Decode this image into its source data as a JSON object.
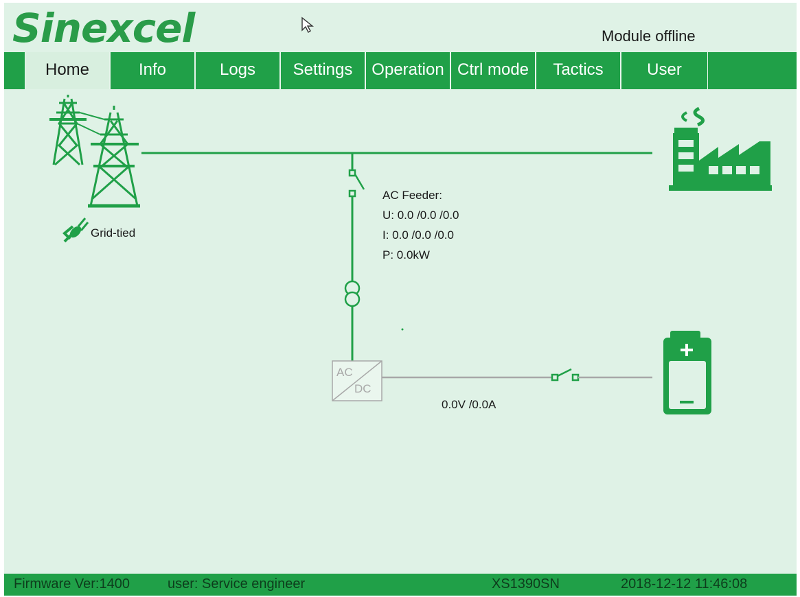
{
  "header": {
    "logo": "Sinexcel",
    "module_status": "Module offline"
  },
  "nav": {
    "tabs": [
      {
        "label": "Home"
      },
      {
        "label": "Info"
      },
      {
        "label": "Logs"
      },
      {
        "label": "Settings"
      },
      {
        "label": "Operation"
      },
      {
        "label": "Ctrl mode"
      },
      {
        "label": "Tactics"
      },
      {
        "label": "User"
      }
    ],
    "active_tab": "Home"
  },
  "diagram": {
    "grid_status": "Grid-tied",
    "feeder": {
      "title": "AC Feeder:",
      "voltage": "U: 0.0 /0.0 /0.0",
      "current": "I: 0.0 /0.0 /0.0",
      "power": "P: 0.0kW"
    },
    "converter": {
      "ac_label": "AC",
      "dc_label": "DC"
    },
    "battery_reading": "0.0V /0.0A",
    "icons": [
      "power-tower-icon",
      "grid-plug-icon",
      "factory-icon",
      "battery-icon",
      "transformer-icon",
      "switch-icon"
    ],
    "colors": {
      "line_green": "#20a048",
      "dc_line_gray": "#a8a8a8",
      "background": "#dff2e6"
    }
  },
  "footer": {
    "firmware": "Firmware Ver:1400",
    "user": "user:  Service engineer",
    "serial": "XS1390SN",
    "datetime": "2018-12-12 11:46:08"
  }
}
